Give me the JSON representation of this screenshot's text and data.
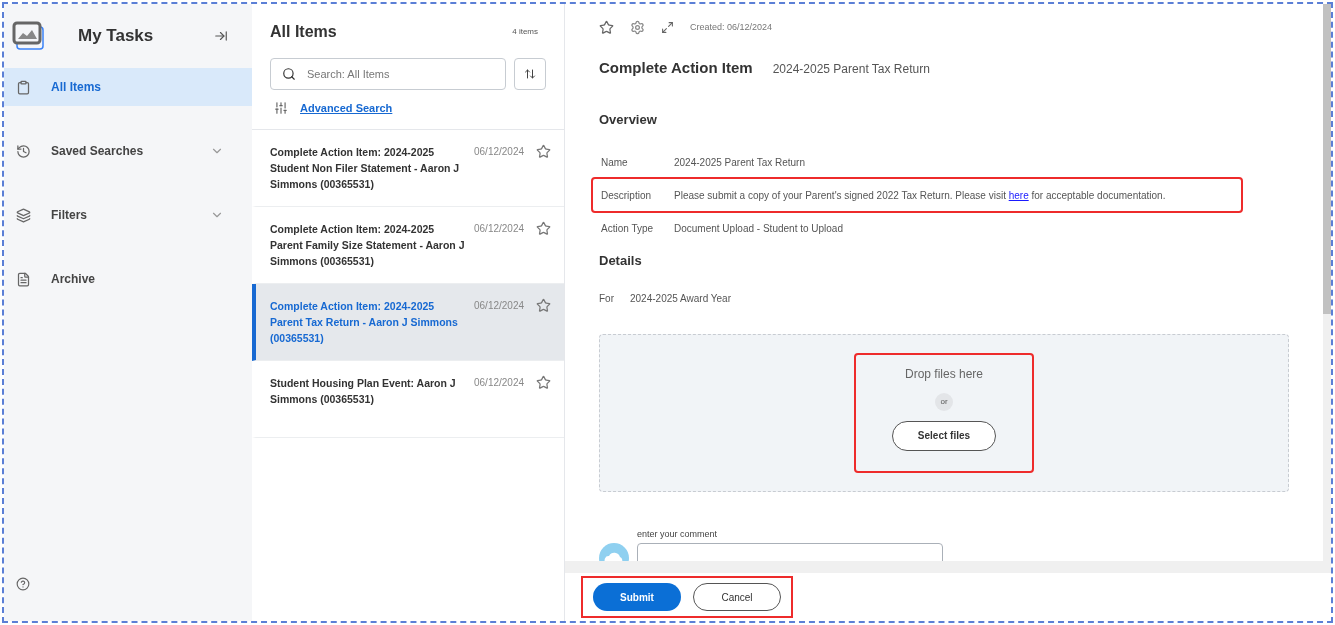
{
  "sidebar": {
    "title": "My Tasks",
    "items": [
      {
        "label": "All Items",
        "selected": true,
        "expandable": false
      },
      {
        "label": "Saved Searches",
        "selected": false,
        "expandable": true
      },
      {
        "label": "Filters",
        "selected": false,
        "expandable": true
      },
      {
        "label": "Archive",
        "selected": false,
        "expandable": false
      }
    ]
  },
  "list": {
    "title": "All Items",
    "count": "4 items",
    "search": {
      "placeholder": "Search: All Items"
    },
    "advanced_search": "Advanced Search",
    "items": [
      {
        "title": "Complete Action Item: 2024-2025 Student Non Filer Statement - Aaron J Simmons (00365531)",
        "date": "06/12/2024",
        "selected": false
      },
      {
        "title": "Complete Action Item: 2024-2025 Parent Family Size Statement - Aaron J Simmons (00365531)",
        "date": "06/12/2024",
        "selected": false
      },
      {
        "title": "Complete Action Item: 2024-2025 Parent Tax Return - Aaron J Simmons (00365531)",
        "date": "06/12/2024",
        "selected": true
      },
      {
        "title": "Student Housing Plan Event: Aaron J Simmons (00365531)",
        "date": "06/12/2024",
        "selected": false
      }
    ]
  },
  "detail": {
    "created": "Created: 06/12/2024",
    "title": "Complete Action Item",
    "subtitle": "2024-2025 Parent Tax Return",
    "overview_heading": "Overview",
    "fields": [
      {
        "label": "Name",
        "value": "2024-2025 Parent Tax Return",
        "highlighted": false
      },
      {
        "label": "Description",
        "value": "Please submit a copy of your Parent's signed 2022 Tax Return. Please visit",
        "link": "here",
        "value_after": "for acceptable documentation.",
        "highlighted": true
      },
      {
        "label": "Action Type",
        "value": "Document Upload - Student to Upload",
        "highlighted": false
      }
    ],
    "details_heading": "Details",
    "for_label": "For",
    "for_value": "2024-2025 Award Year",
    "dropzone": {
      "text": "Drop files here",
      "or": "or",
      "button": "Select files"
    },
    "comment": {
      "label": "enter your comment"
    }
  },
  "footer": {
    "submit": "Submit",
    "cancel": "Cancel"
  }
}
